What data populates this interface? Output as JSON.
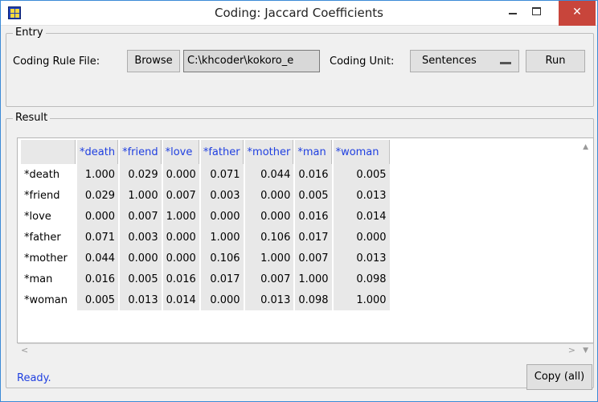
{
  "window": {
    "title": "Coding: Jaccard Coefficients",
    "minimize_glyph": "",
    "maximize_glyph": "",
    "close_glyph": "✕"
  },
  "entry": {
    "legend": "Entry",
    "coding_rule_label": "Coding Rule File:",
    "browse_label": "Browse",
    "file_value": "C:\\khcoder\\kokoro_e",
    "coding_unit_label": "Coding Unit:",
    "coding_unit_value": "Sentences",
    "run_label": "Run"
  },
  "result": {
    "legend": "Result",
    "columns": [
      "*death",
      "*friend",
      "*love",
      "*father",
      "*mother",
      "*man",
      "*woman"
    ],
    "rows": [
      {
        "name": "*death",
        "values": [
          "1.000",
          "0.029",
          "0.000",
          "0.071",
          "0.044",
          "0.016",
          "0.005"
        ]
      },
      {
        "name": "*friend",
        "values": [
          "0.029",
          "1.000",
          "0.007",
          "0.003",
          "0.000",
          "0.005",
          "0.013"
        ]
      },
      {
        "name": "*love",
        "values": [
          "0.000",
          "0.007",
          "1.000",
          "0.000",
          "0.000",
          "0.016",
          "0.014"
        ]
      },
      {
        "name": "*father",
        "values": [
          "0.071",
          "0.003",
          "0.000",
          "1.000",
          "0.106",
          "0.017",
          "0.000"
        ]
      },
      {
        "name": "*mother",
        "values": [
          "0.044",
          "0.000",
          "0.000",
          "0.106",
          "1.000",
          "0.007",
          "0.013"
        ]
      },
      {
        "name": "*man",
        "values": [
          "0.016",
          "0.005",
          "0.016",
          "0.017",
          "0.007",
          "1.000",
          "0.098"
        ]
      },
      {
        "name": "*woman",
        "values": [
          "0.005",
          "0.013",
          "0.014",
          "0.000",
          "0.013",
          "0.098",
          "1.000"
        ]
      }
    ]
  },
  "status": "Ready.",
  "copy_label": "Copy (all)",
  "colors": {
    "header_text": "#1f3fe0",
    "status_text": "#1f3fe0",
    "close_button": "#c8453b"
  }
}
